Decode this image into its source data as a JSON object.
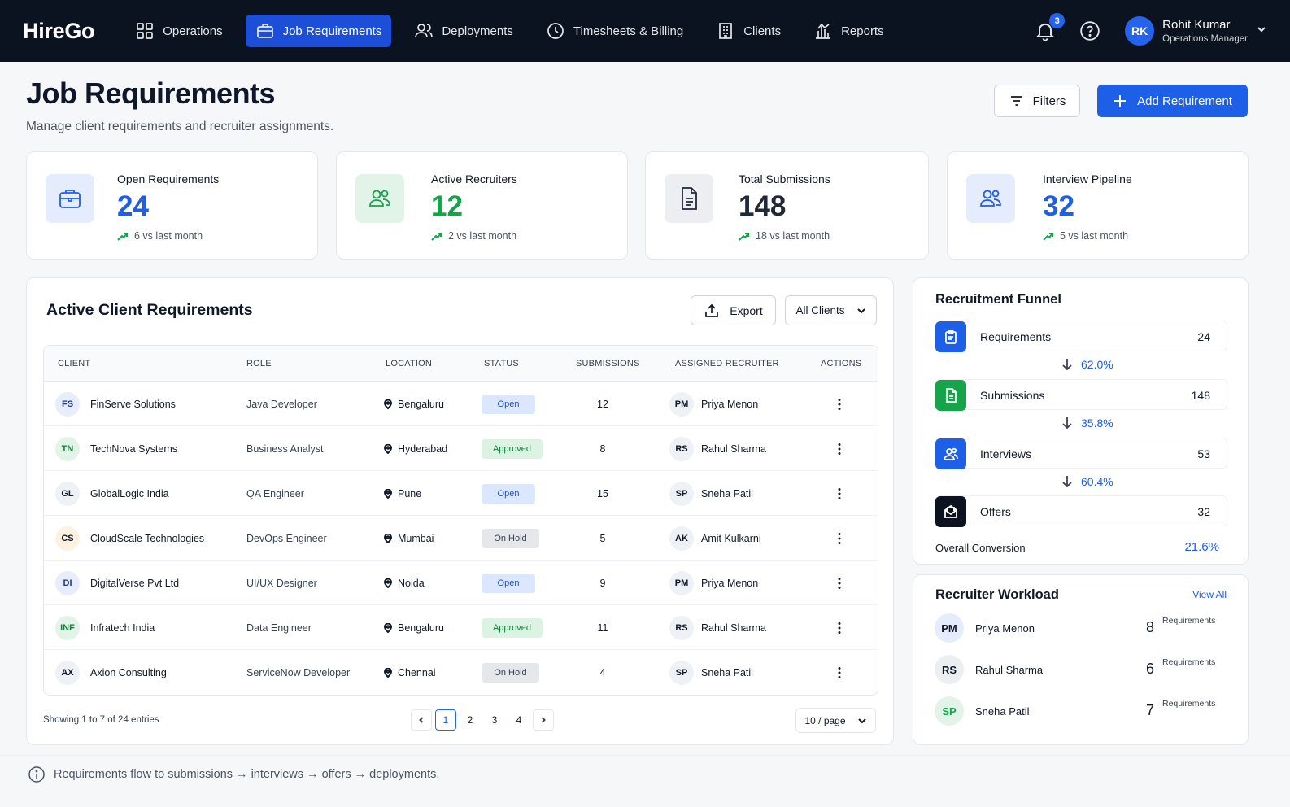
{
  "brand": "HireGo",
  "nav": {
    "items": [
      {
        "label": "Operations",
        "icon": "grid-icon"
      },
      {
        "label": "Job Requirements",
        "icon": "briefcase-icon"
      },
      {
        "label": "Deployments",
        "icon": "users-icon"
      },
      {
        "label": "Timesheets & Billing",
        "icon": "clock-icon"
      },
      {
        "label": "Clients",
        "icon": "building-icon"
      },
      {
        "label": "Reports",
        "icon": "chart-icon"
      }
    ],
    "active": "Job Requirements",
    "notifications": "3",
    "user": {
      "initials": "RK",
      "name": "Rohit Kumar",
      "role": "Operations Manager"
    }
  },
  "header": {
    "title": "Job Requirements",
    "subtitle": "Manage client requirements and recruiter assignments.",
    "filters_label": "Filters",
    "add_label": "Add Requirement"
  },
  "stats": [
    {
      "label": "Open Requirements",
      "value": "24",
      "trend": "6 vs last month",
      "color": "#1d5fe6"
    },
    {
      "label": "Active Recruiters",
      "value": "12",
      "trend": "2 vs last month",
      "color": "#16a34a"
    },
    {
      "label": "Total Submissions",
      "value": "148",
      "trend": "18 vs last month",
      "color": "#1f2937"
    },
    {
      "label": "Interview Pipeline",
      "value": "32",
      "trend": "5 vs last month",
      "color": "#1d5fe6"
    }
  ],
  "table": {
    "title": "Active Client Requirements",
    "export_label": "Export",
    "client_filter": "All Clients",
    "columns": [
      "CLIENT",
      "ROLE",
      "LOCATION",
      "STATUS",
      "SUBMISSIONS",
      "ASSIGNED RECRUITER",
      "ACTIONS"
    ],
    "rows": [
      {
        "initials": "FS",
        "client": "FinServe Solutions",
        "role": "Java Developer",
        "location": "Bengaluru",
        "status": "Open",
        "submissions": "12",
        "rec_initials": "PM",
        "recruiter": "Priya Menon"
      },
      {
        "initials": "TN",
        "client": "TechNova Systems",
        "role": "Business Analyst",
        "location": "Hyderabad",
        "status": "Approved",
        "submissions": "8",
        "rec_initials": "RS",
        "recruiter": "Rahul Sharma"
      },
      {
        "initials": "GL",
        "client": "GlobalLogic India",
        "role": "QA Engineer",
        "location": "Pune",
        "status": "Open",
        "submissions": "15",
        "rec_initials": "SP",
        "recruiter": "Sneha Patil"
      },
      {
        "initials": "CS",
        "client": "CloudScale Technologies",
        "role": "DevOps Engineer",
        "location": "Mumbai",
        "status": "On Hold",
        "submissions": "5",
        "rec_initials": "AK",
        "recruiter": "Amit Kulkarni"
      },
      {
        "initials": "DI",
        "client": "DigitalVerse Pvt Ltd",
        "role": "UI/UX Designer",
        "location": "Noida",
        "status": "Open",
        "submissions": "9",
        "rec_initials": "PM",
        "recruiter": "Priya Menon"
      },
      {
        "initials": "INF",
        "client": "Infratech India",
        "role": "Data Engineer",
        "location": "Bengaluru",
        "status": "Approved",
        "submissions": "11",
        "rec_initials": "RS",
        "recruiter": "Rahul Sharma"
      },
      {
        "initials": "AX",
        "client": "Axion Consulting",
        "role": "ServiceNow Developer",
        "location": "Chennai",
        "status": "On Hold",
        "submissions": "4",
        "rec_initials": "SP",
        "recruiter": "Sneha Patil"
      }
    ],
    "showing": "Showing 1 to 7 of 24 entries",
    "pages": [
      "1",
      "2",
      "3",
      "4"
    ],
    "current_page": "1",
    "per_page": "10 / page"
  },
  "funnel": {
    "title": "Recruitment Funnel",
    "stages": [
      {
        "label": "Requirements",
        "value": "24",
        "color": "#1d5fe6",
        "icon": "clipboard-icon"
      },
      {
        "label": "Submissions",
        "value": "148",
        "color": "#16a34a",
        "icon": "document-icon"
      },
      {
        "label": "Interviews",
        "value": "53",
        "color": "#1d5fe6",
        "icon": "users-icon"
      },
      {
        "label": "Offers",
        "value": "32",
        "color": "#0b1220",
        "icon": "envelope-icon"
      }
    ],
    "conversions": [
      "62.0%",
      "35.8%",
      "60.4%"
    ],
    "overall_label": "Overall Conversion",
    "overall_value": "21.6%"
  },
  "workload": {
    "title": "Recruiter Workload",
    "view_all": "View All",
    "unit": "Requirements",
    "recruiters": [
      {
        "initials": "PM",
        "name": "Priya Menon",
        "count": "8"
      },
      {
        "initials": "RS",
        "name": "Rahul Sharma",
        "count": "6"
      },
      {
        "initials": "SP",
        "name": "Sneha Patil",
        "count": "7"
      }
    ]
  },
  "footer_note": "Requirements flow to submissions → interviews → offers → deployments."
}
